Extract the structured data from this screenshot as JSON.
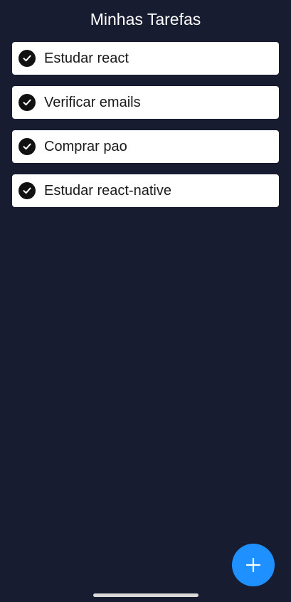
{
  "header": {
    "title": "Minhas Tarefas"
  },
  "tasks": [
    {
      "label": "Estudar react",
      "done": true
    },
    {
      "label": "Verificar emails",
      "done": true
    },
    {
      "label": "Comprar pao",
      "done": true
    },
    {
      "label": "Estudar react-native",
      "done": true
    }
  ],
  "fab": {
    "icon": "plus-icon",
    "color": "#1e90ff"
  },
  "colors": {
    "background": "#171c30",
    "card": "#ffffff",
    "check": "#111111"
  }
}
